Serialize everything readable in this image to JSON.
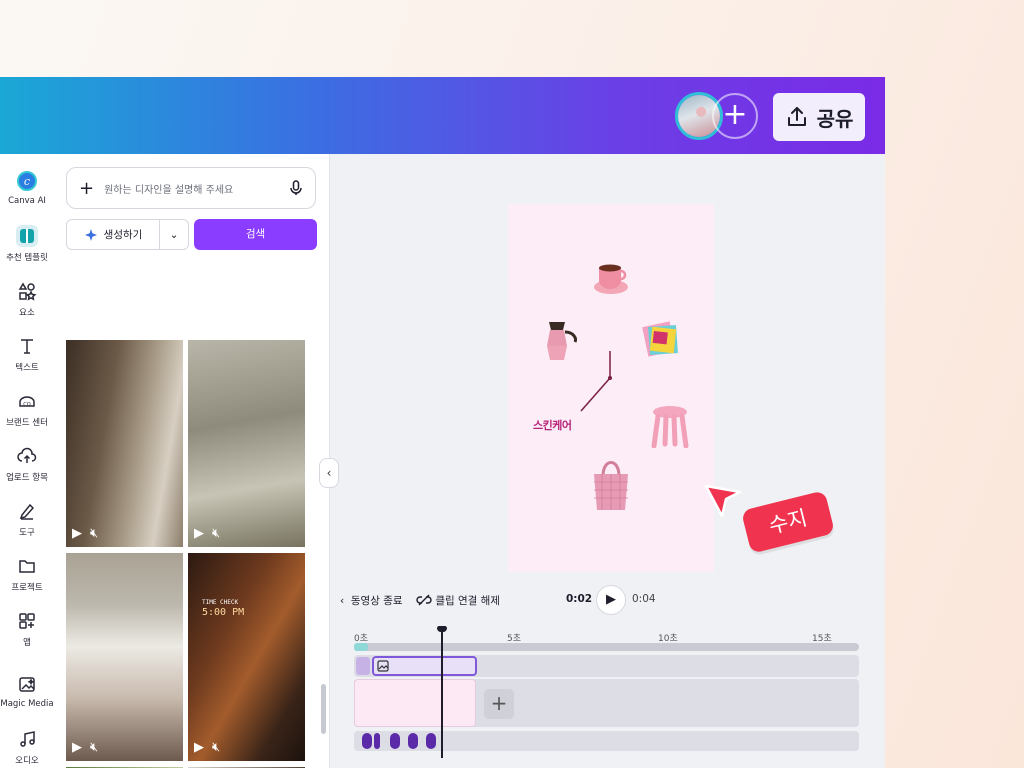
{
  "topbar": {
    "share_label": "공유",
    "add_collaborator": "+"
  },
  "rail": {
    "items": [
      {
        "label": "Canva AI",
        "icon": "canva-ai-icon"
      },
      {
        "label": "추천 템플릿",
        "icon": "templates-icon"
      },
      {
        "label": "요소",
        "icon": "elements-icon"
      },
      {
        "label": "텍스트",
        "icon": "text-icon"
      },
      {
        "label": "브랜드 센터",
        "icon": "brand-icon"
      },
      {
        "label": "업로드 항목",
        "icon": "upload-icon"
      },
      {
        "label": "도구",
        "icon": "draw-icon"
      },
      {
        "label": "프로젝트",
        "icon": "folder-icon"
      },
      {
        "label": "앱",
        "icon": "apps-icon"
      },
      {
        "label": "Magic Media",
        "icon": "magic-media-icon"
      },
      {
        "label": "오디오",
        "icon": "audio-icon"
      }
    ]
  },
  "panel": {
    "search_placeholder": "원하는 디자인을 설명해 주세요",
    "generate_label": "생성하기",
    "search_label": "검색",
    "thumb_clock_text": "TIME CHECK",
    "thumb_clock_time": "5:00 PM"
  },
  "canvas": {
    "brand_word": "스킨케어",
    "collaborator_cursor_name": "수지"
  },
  "playback": {
    "end_video_label": "동영상 종료",
    "unlink_clip_label": "클립 연결 해제",
    "current_time": "0:02",
    "total_time": "0:04"
  },
  "timeline": {
    "ruler_marks": [
      "0초",
      "5초",
      "10초",
      "15초"
    ]
  },
  "colors": {
    "accent": "#8b3dff",
    "cursor_tag": "#f0344f",
    "design_bg": "#fcedf6"
  }
}
